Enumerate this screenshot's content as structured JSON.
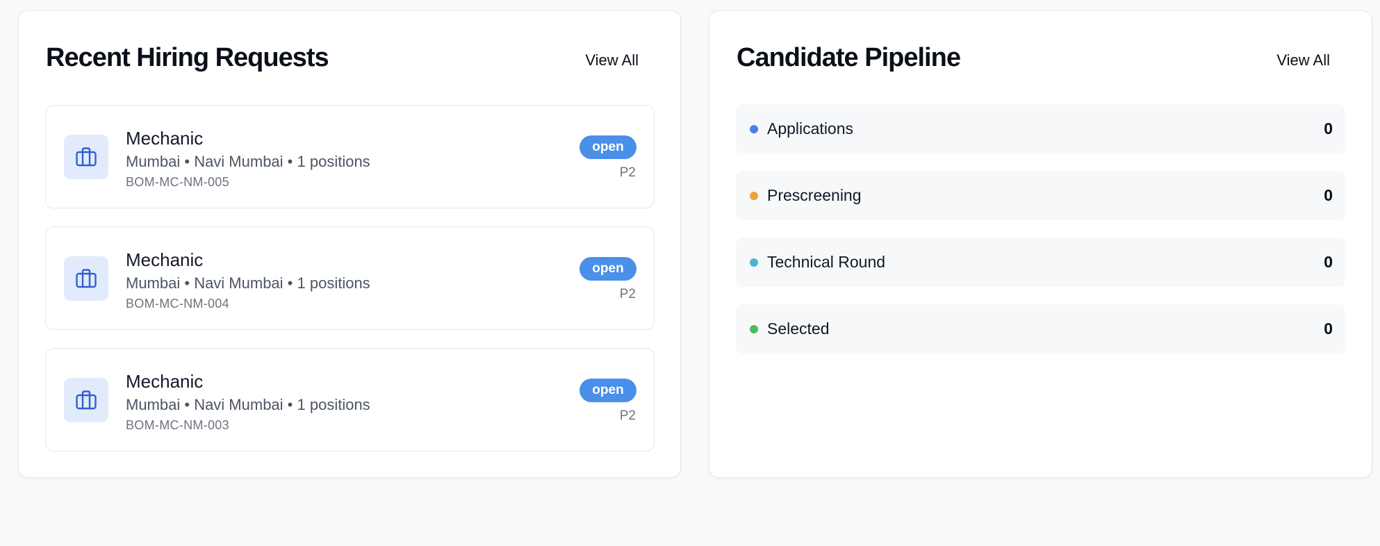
{
  "hiring": {
    "title": "Recent Hiring Requests",
    "view_all": "View All",
    "requests": [
      {
        "title": "Mechanic",
        "location": "Mumbai",
        "area": "Navi Mumbai",
        "positions": "1 positions",
        "code": "BOM-MC-NM-005",
        "status": "open",
        "priority": "P2"
      },
      {
        "title": "Mechanic",
        "location": "Mumbai",
        "area": "Navi Mumbai",
        "positions": "1 positions",
        "code": "BOM-MC-NM-004",
        "status": "open",
        "priority": "P2"
      },
      {
        "title": "Mechanic",
        "location": "Mumbai",
        "area": "Navi Mumbai",
        "positions": "1 positions",
        "code": "BOM-MC-NM-003",
        "status": "open",
        "priority": "P2"
      }
    ],
    "icon": "briefcase-icon",
    "status_color": "#4a8fe8"
  },
  "pipeline": {
    "title": "Candidate Pipeline",
    "view_all": "View All",
    "stages": [
      {
        "label": "Applications",
        "count": "0",
        "color": "#4a7fe6"
      },
      {
        "label": "Prescreening",
        "count": "0",
        "color": "#f0a23a"
      },
      {
        "label": "Technical Round",
        "count": "0",
        "color": "#4cb3cf"
      },
      {
        "label": "Selected",
        "count": "0",
        "color": "#4cbd5c"
      }
    ]
  }
}
